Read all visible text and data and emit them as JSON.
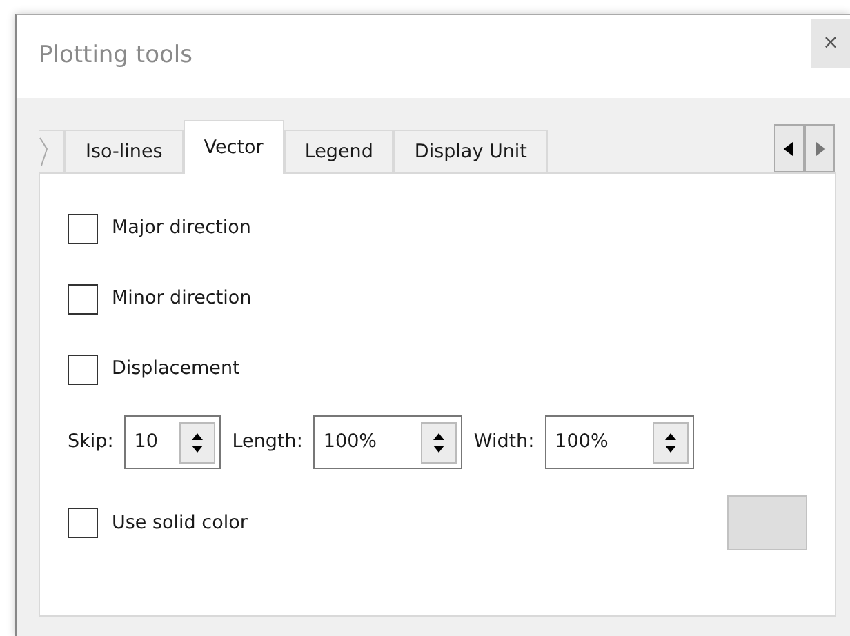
{
  "window": {
    "title": "Plotting tools",
    "close": "×"
  },
  "tabs": [
    {
      "label": "Iso-lines",
      "selected": false
    },
    {
      "label": "Vector",
      "selected": true
    },
    {
      "label": "Legend",
      "selected": false
    },
    {
      "label": "Display Unit",
      "selected": false
    }
  ],
  "tab_scroll": {
    "left_disabled": false,
    "right_disabled": true
  },
  "options": [
    {
      "label": "Major direction",
      "checked": false
    },
    {
      "label": "Minor direction",
      "checked": false
    },
    {
      "label": "Displacement",
      "checked": false
    }
  ],
  "spinners": [
    {
      "label": "Skip:",
      "value": "10",
      "kind": "narrow"
    },
    {
      "label": "Length:",
      "value": "100%",
      "kind": "wide"
    },
    {
      "label": "Width:",
      "value": "100%",
      "kind": "wide"
    }
  ],
  "solid_color": {
    "label": "Use solid color",
    "checked": false
  }
}
